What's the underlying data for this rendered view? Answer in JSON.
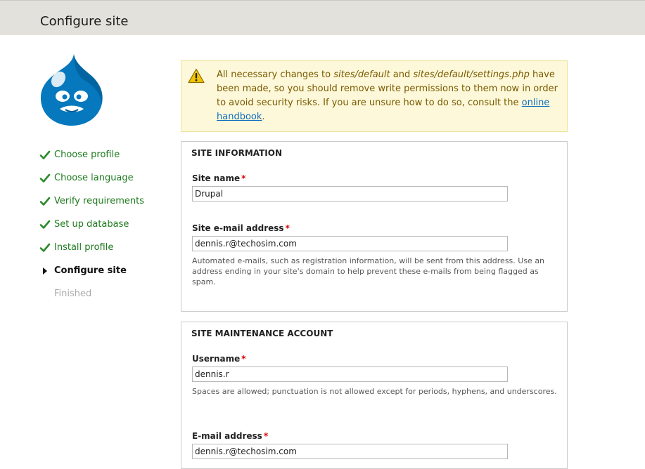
{
  "header": {
    "title": "Configure site"
  },
  "logo": {
    "icon": "drupal-drop-logo",
    "colors": {
      "primary": "#0678be",
      "dark": "#00598e"
    }
  },
  "steps": [
    {
      "label": "Choose profile",
      "state": "done"
    },
    {
      "label": "Choose language",
      "state": "done"
    },
    {
      "label": "Verify requirements",
      "state": "done"
    },
    {
      "label": "Set up database",
      "state": "done"
    },
    {
      "label": "Install profile",
      "state": "done"
    },
    {
      "label": "Configure site",
      "state": "active"
    },
    {
      "label": "Finished",
      "state": "pending"
    }
  ],
  "warning": {
    "icon": "warning-triangle-icon",
    "text_1": "All necessary changes to ",
    "path_1": "sites/default",
    "text_2": " and ",
    "path_2": "sites/default/settings.php",
    "text_3": " have been made, so you should remove write permissions to them now in order to avoid security risks. If you are unsure how to do so, consult the ",
    "link": "online handbook",
    "text_4": "."
  },
  "site_information": {
    "legend": "SITE INFORMATION",
    "site_name": {
      "label": "Site name",
      "required_mark": "*",
      "value": "Drupal"
    },
    "site_email": {
      "label": "Site e-mail address",
      "required_mark": "*",
      "value": "dennis.r@techosim.com",
      "description": "Automated e-mails, such as registration information, will be sent from this address. Use an address ending in your site's domain to help prevent these e-mails from being flagged as spam."
    }
  },
  "maintenance_account": {
    "legend": "SITE MAINTENANCE ACCOUNT",
    "username": {
      "label": "Username",
      "required_mark": "*",
      "value": "dennis.r",
      "description": "Spaces are allowed; punctuation is not allowed except for periods, hyphens, and underscores."
    },
    "email": {
      "label": "E-mail address",
      "required_mark": "*",
      "value": "dennis.r@techosim.com"
    }
  }
}
